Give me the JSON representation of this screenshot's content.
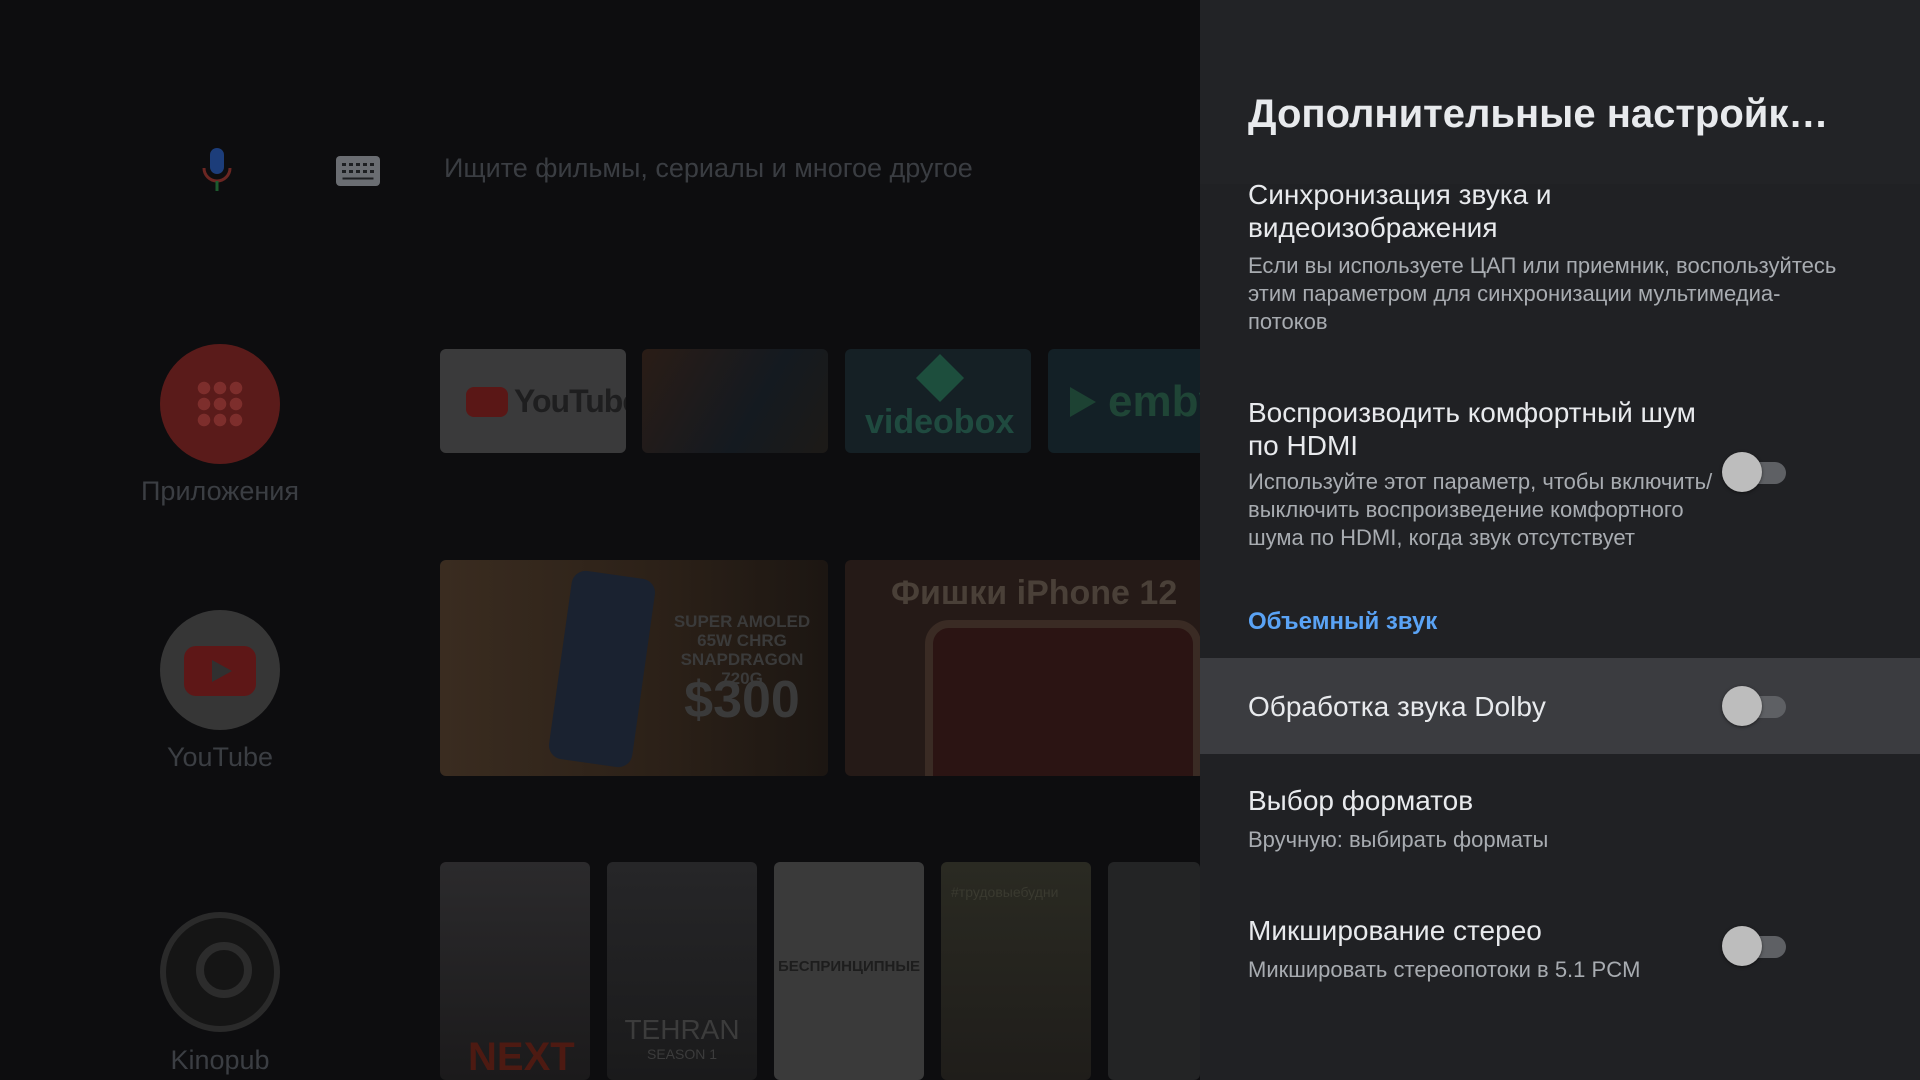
{
  "launcher": {
    "search_placeholder": "Ищите фильмы, сериалы и многое другое",
    "rows": [
      {
        "label": "Приложения",
        "icon": "apps-grid-icon"
      },
      {
        "label": "YouTube",
        "icon": "youtube-icon"
      },
      {
        "label": "Kinopub",
        "icon": "kinopub-icon"
      }
    ],
    "app_tiles": [
      {
        "name": "YouTube"
      },
      {
        "name": "videobox"
      },
      {
        "name": "emby"
      }
    ],
    "video_tiles": [
      {
        "line1": "SUPER AMOLED",
        "line2": "65W CHRG",
        "line3": "SNAPDRAGON 720G",
        "price": "$300"
      },
      {
        "title": "Фишки iPhone 12"
      }
    ],
    "posters": [
      {
        "title": "NEXT"
      },
      {
        "title": "TEHRAN",
        "subtitle": "SEASON 1"
      },
      {
        "title": "БЕСПРИНЦИПНЫЕ"
      },
      {
        "title": "#трудовыебудни"
      },
      {
        "title": ""
      }
    ]
  },
  "settings": {
    "title": "Дополнительные настройки звука",
    "items": [
      {
        "title": "Синхронизация звука и видеоизображения",
        "subtitle": "Если вы используете ЦАП или приемник, воспользуйтесь этим параметром для синхронизации мультимедиа-потоков"
      },
      {
        "title": "Воспроизводить комфортный шум по HDMI",
        "subtitle": "Используйте этот параметр, чтобы включить/выключить воспроизведение комфортного шума по HDMI, когда звук отсутствует",
        "toggle": false
      }
    ],
    "section_label": "Объемный звук",
    "surround_items": [
      {
        "title": "Обработка звука Dolby",
        "toggle": false,
        "focused": true
      },
      {
        "title": "Выбор форматов",
        "subtitle": "Вручную: выбирать форматы"
      },
      {
        "title": "Микширование стерео",
        "subtitle": "Микшировать стереопотоки в 5.1 PCM",
        "toggle": false
      }
    ]
  },
  "colors": {
    "panel_bg": "#202124",
    "focused_bg": "#3b3c40",
    "accent": "#5aa3f5",
    "toggle_off_track": "#5e6064",
    "toggle_off_thumb": "#bdbdbd"
  }
}
